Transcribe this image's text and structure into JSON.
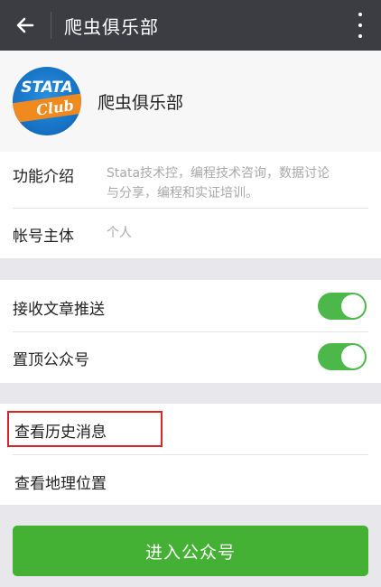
{
  "header": {
    "title": "爬虫俱乐部",
    "back_icon": "arrow-left-icon",
    "more_icon": "more-vertical-icon"
  },
  "profile": {
    "logo_text_top": "STATA",
    "logo_text_bottom": "Club",
    "name": "爬虫俱乐部"
  },
  "info": {
    "intro_label": "功能介绍",
    "intro_value_line1": "Stata技术控，编程技术咨询，数据讨论",
    "intro_value_line2": "与分享，编程和实证培训。",
    "owner_label": "帐号主体",
    "owner_value": "个人"
  },
  "settings": {
    "receive_label": "接收文章推送",
    "receive_on": true,
    "pin_label": "置顶公众号",
    "pin_on": true
  },
  "links": {
    "history_label": "查看历史消息",
    "location_label": "查看地理位置"
  },
  "actions": {
    "enter_label": "进入公众号"
  },
  "colors": {
    "topbar": "#3b3d42",
    "toggle_on": "#4cb84a",
    "primary_button": "#44b034",
    "highlight_border": "#d9252a"
  }
}
